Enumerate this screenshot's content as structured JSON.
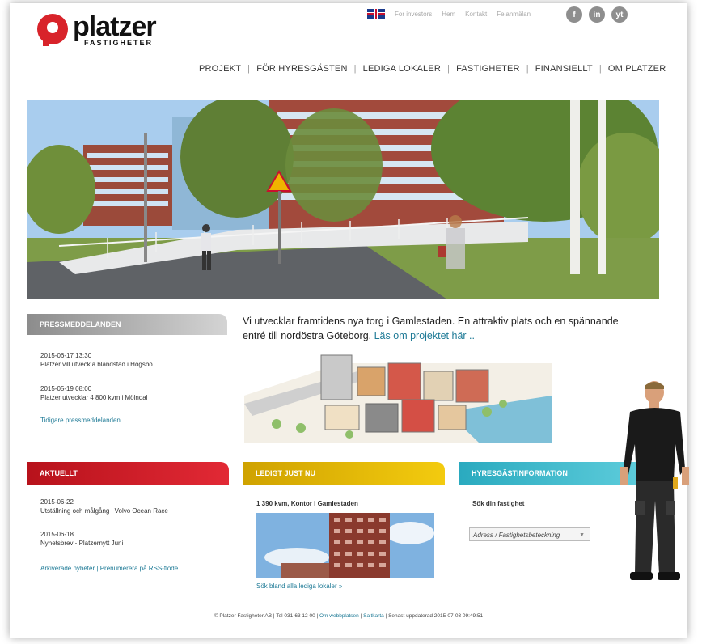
{
  "brand": {
    "name": "platzer",
    "sub": "FASTIGHETER"
  },
  "top_links": [
    "For investors",
    "Hem",
    "Kontakt",
    "Felanmälan"
  ],
  "social": [
    "f",
    "in",
    "yt"
  ],
  "nav": [
    "PROJEKT",
    "FÖR HYRESGÄSTEN",
    "LEDIGA LOKALER",
    "FASTIGHETER",
    "FINANSIELLT",
    "OM PLATZER"
  ],
  "press": {
    "heading": "PRESSMEDDELANDEN",
    "items": [
      {
        "date": "2015-06-17 13:30",
        "text": "Platzer vill utveckla blandstad i Högsbo"
      },
      {
        "date": "2015-05-19 08:00",
        "text": "Platzer utvecklar 4 800 kvm i Mölndal"
      }
    ],
    "more": "Tidigare pressmeddelanden"
  },
  "intro": {
    "text": "Vi utvecklar framtidens nya torg i Gamlestaden. En attraktiv plats och en spännande entré till nordöstra Göteborg.",
    "link": "Läs om projektet här .."
  },
  "news": {
    "heading": "AKTUELLT",
    "items": [
      {
        "date": "2015-06-22",
        "text": "Utställning och målgång i Volvo Ocean Race"
      },
      {
        "date": "2015-06-18",
        "text": "Nyhetsbrev - Platzernytt Juni"
      }
    ],
    "link1": "Arkiverade nyheter",
    "sep": "|",
    "link2": "Prenumerera på RSS-flöde"
  },
  "vacant": {
    "heading": "LEDIGT JUST NU",
    "title": "1 390 kvm, Kontor i Gamlestaden",
    "link": "Sök bland alla lediga lokaler »"
  },
  "tenant": {
    "heading": "HYRESGÄSTINFORMATION",
    "label": "Sök din fastighet",
    "select_value": "Adress / Fastighetsbeteckning"
  },
  "footer": {
    "pre": "© Platzer Fastigheter AB | Tel 031-63 12 00 |",
    "link1": "Om webbplatsen",
    "sep": "|",
    "link2": "Sajtkarta",
    "post": "| Senast uppdaterad 2015-07-03 09:49:51"
  },
  "colors": {
    "red": "#d8232a",
    "yellow": "#e8bc07",
    "cyan": "#3fb9cb",
    "link": "#1e7a96"
  }
}
